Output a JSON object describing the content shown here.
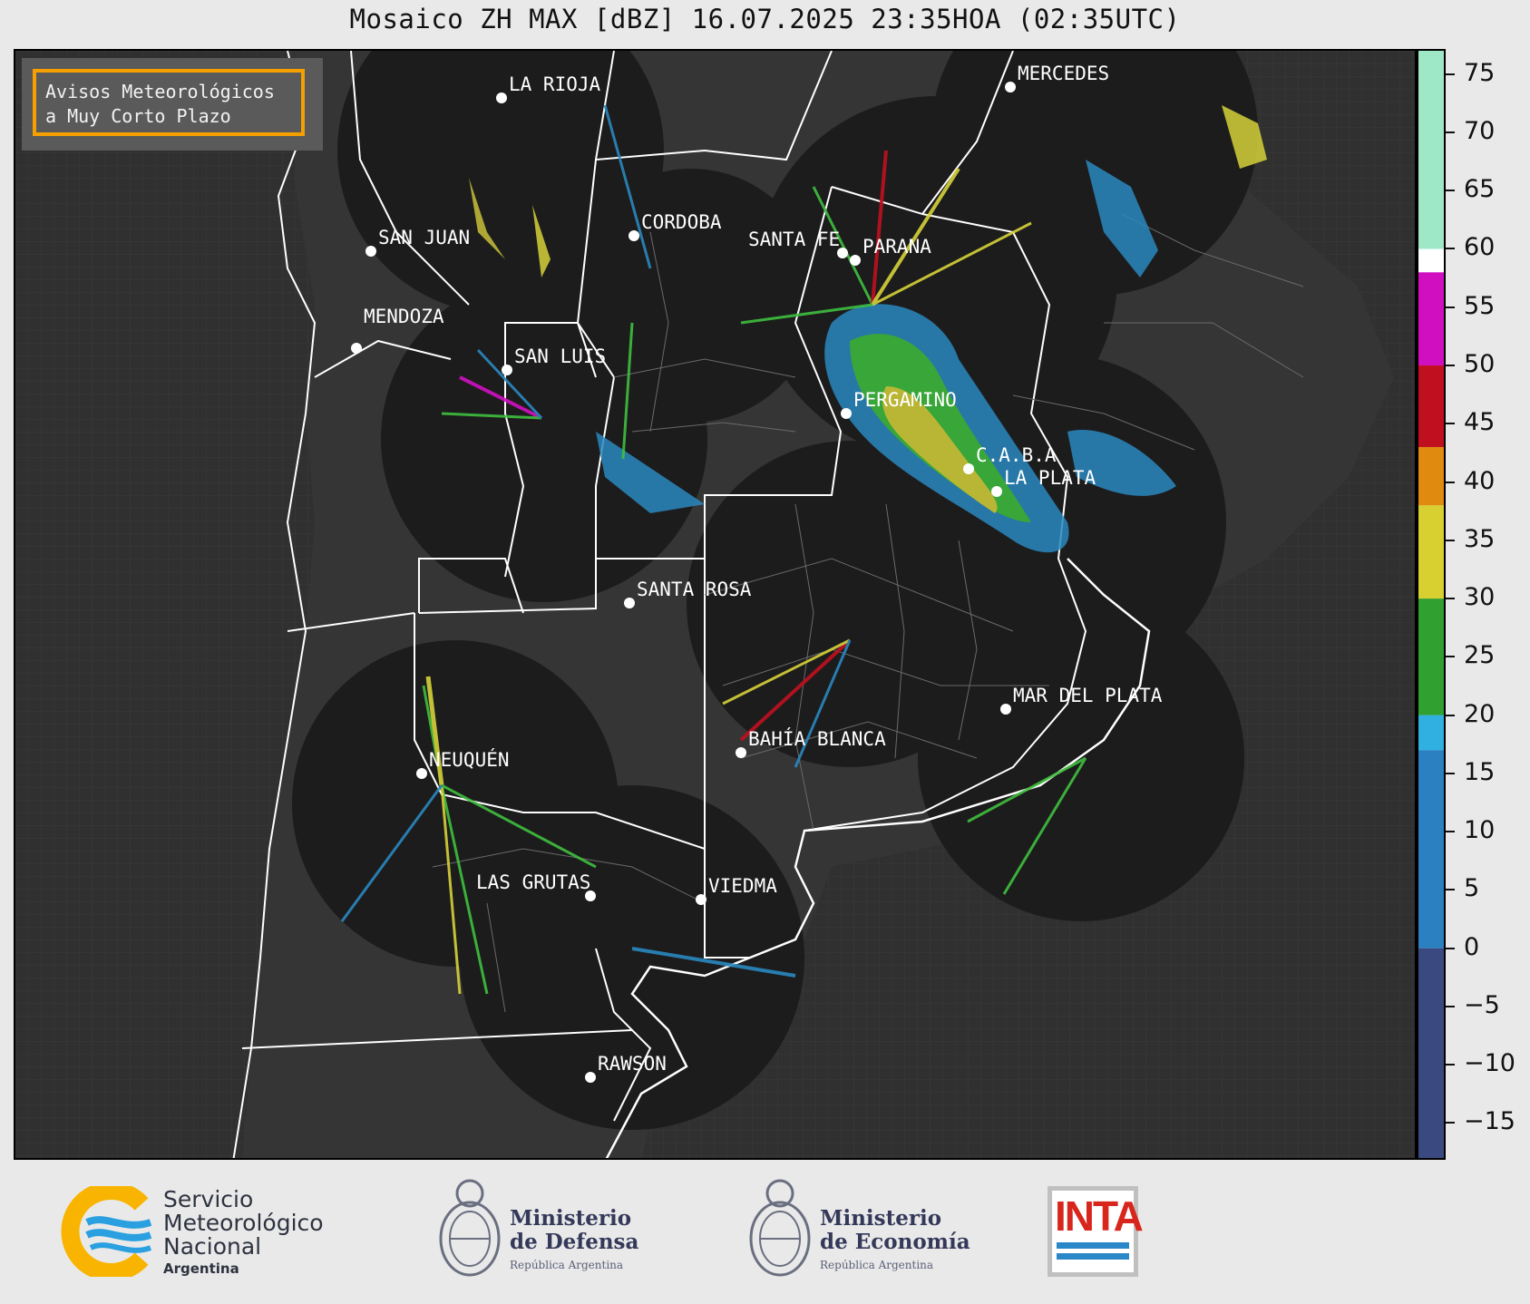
{
  "title": "Mosaico ZH MAX [dBZ] 16.07.2025 23:35HOA (02:35UTC)",
  "notice": {
    "line1": "Avisos Meteorológicos",
    "line2": "a Muy Corto Plazo",
    "border_color": "#f5a000"
  },
  "colorbar": {
    "unit": "dBZ",
    "range": [
      -18,
      77
    ],
    "ticks": [
      "75",
      "70",
      "65",
      "60",
      "55",
      "50",
      "45",
      "40",
      "35",
      "30",
      "25",
      "20",
      "15",
      "10",
      "5",
      "0",
      "−5",
      "−10",
      "−15"
    ],
    "bands": [
      {
        "from": -18,
        "to": 0,
        "color": "#3a4a80"
      },
      {
        "from": 0,
        "to": 17,
        "color": "#2a80c0"
      },
      {
        "from": 17,
        "to": 20,
        "color": "#30b0e0"
      },
      {
        "from": 20,
        "to": 30,
        "color": "#30a030"
      },
      {
        "from": 30,
        "to": 38,
        "color": "#d8d030"
      },
      {
        "from": 38,
        "to": 43,
        "color": "#e08a10"
      },
      {
        "from": 43,
        "to": 50,
        "color": "#c01020"
      },
      {
        "from": 50,
        "to": 58,
        "color": "#d010c0"
      },
      {
        "from": 58,
        "to": 60,
        "color": "#ffffff"
      },
      {
        "from": 60,
        "to": 77,
        "color": "#9ee8c8"
      }
    ]
  },
  "cities": [
    {
      "name": "LA RIOJA"
    },
    {
      "name": "SAN JUAN"
    },
    {
      "name": "CORDOBA"
    },
    {
      "name": "SANTA FE"
    },
    {
      "name": "PARANA"
    },
    {
      "name": "MENDOZA"
    },
    {
      "name": "SAN LUIS"
    },
    {
      "name": "MERCEDES"
    },
    {
      "name": "PERGAMINO"
    },
    {
      "name": "C.A.B.A"
    },
    {
      "name": "LA PLATA"
    },
    {
      "name": "SANTA ROSA"
    },
    {
      "name": "MAR DEL PLATA"
    },
    {
      "name": "BAHÍA BLANCA"
    },
    {
      "name": "NEUQUÉN"
    },
    {
      "name": "LAS GRUTAS"
    },
    {
      "name": "VIEDMA"
    },
    {
      "name": "RAWSON"
    }
  ],
  "logos": {
    "smn": {
      "line1": "Servicio",
      "line2": "Meteorológico",
      "line3": "Nacional",
      "line4": "Argentina"
    },
    "defensa": {
      "line1": "Ministerio",
      "line2": "de Defensa",
      "line3": "República Argentina"
    },
    "economia": {
      "line1": "Ministerio",
      "line2": "de Economía",
      "line3": "República Argentina"
    },
    "inta": {
      "text": "INTA"
    }
  }
}
